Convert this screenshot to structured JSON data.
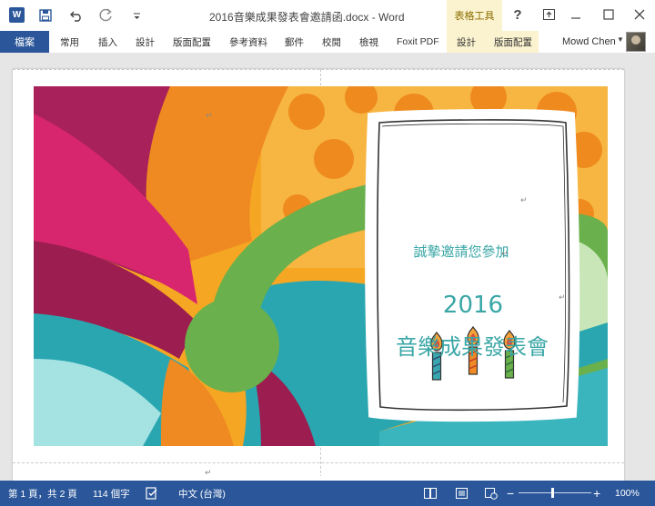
{
  "window": {
    "title": "2016音樂成果發表會邀請函.docx - Word",
    "tool_tab_group": "表格工具",
    "app_icon": "W"
  },
  "quick_access": {
    "save_icon": "save-icon",
    "undo_icon": "undo-icon",
    "redo_icon": "redo-icon",
    "customize_icon": "customize-icon"
  },
  "ribbon": {
    "file_tab": "檔案",
    "tabs": [
      "常用",
      "插入",
      "設計",
      "版面配置",
      "參考資料",
      "郵件",
      "校閱",
      "檢視",
      "Foxit PDF"
    ],
    "tool_tabs": [
      "設計",
      "版面配置"
    ],
    "user_name": "Mowd Chen"
  },
  "card": {
    "invite_line": "誠摯邀請您參加",
    "year": "2016",
    "event_name": "音樂成果發表會"
  },
  "status": {
    "page": "第 1 頁，共 2 頁",
    "word_count": "114 個字",
    "language": "中文 (台灣)",
    "zoom": "100%",
    "zoom_level_percent": 100
  },
  "colors": {
    "word_blue": "#2b579a",
    "tool_tab_yellow": "#fbf3cf",
    "card_text_teal": "#3aa6a6",
    "magenta": "#d6256c",
    "orange": "#f08a24",
    "green": "#6ab04c",
    "teal": "#2aa6b0"
  }
}
